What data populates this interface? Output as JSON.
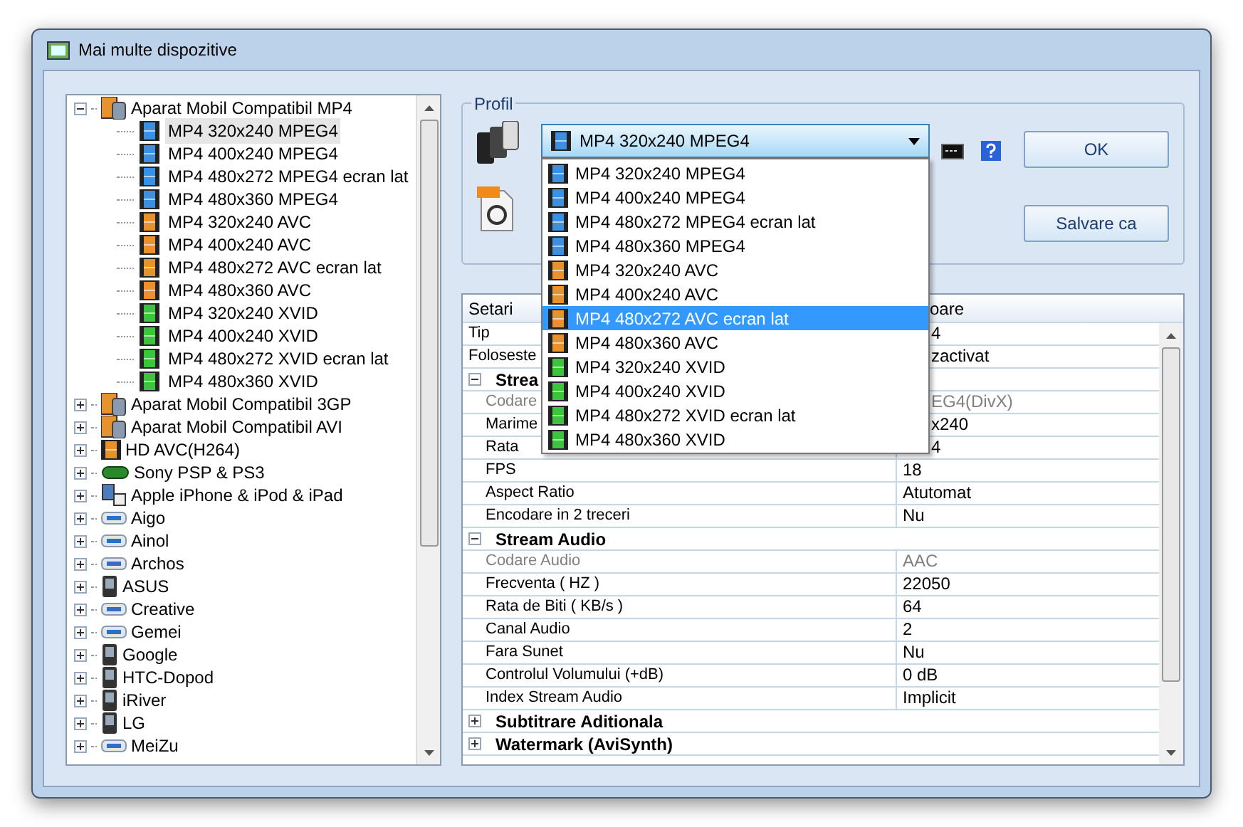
{
  "window": {
    "title": "Mai multe dispozitive"
  },
  "tree": [
    {
      "label": "Aparat Mobil Compatibil MP4",
      "kind": "phone-film",
      "expanded": true,
      "children": [
        {
          "label": "MP4 320x240 MPEG4",
          "color": "#3d8fe0",
          "selected": true
        },
        {
          "label": "MP4 400x240 MPEG4",
          "color": "#3d8fe0",
          "selected": false
        },
        {
          "label": "MP4 480x272 MPEG4 ecran lat",
          "color": "#3d8fe0",
          "selected": false
        },
        {
          "label": "MP4 480x360 MPEG4",
          "color": "#3d8fe0",
          "selected": false
        },
        {
          "label": "MP4 320x240 AVC",
          "color": "#e8922e",
          "selected": false
        },
        {
          "label": "MP4 400x240 AVC",
          "color": "#e8922e",
          "selected": false
        },
        {
          "label": "MP4 480x272 AVC ecran lat",
          "color": "#e8922e",
          "selected": false
        },
        {
          "label": "MP4 480x360 AVC",
          "color": "#e8922e",
          "selected": false
        },
        {
          "label": "MP4 320x240 XVID",
          "color": "#3cc43c",
          "selected": false
        },
        {
          "label": "MP4 400x240 XVID",
          "color": "#3cc43c",
          "selected": false
        },
        {
          "label": "MP4 480x272 XVID ecran lat",
          "color": "#3cc43c",
          "selected": false
        },
        {
          "label": "MP4 480x360 XVID",
          "color": "#3cc43c",
          "selected": false
        }
      ]
    },
    {
      "label": "Aparat Mobil Compatibil 3GP",
      "kind": "phone-film",
      "expanded": false
    },
    {
      "label": "Aparat Mobil Compatibil AVI",
      "kind": "phone-film",
      "expanded": false
    },
    {
      "label": "HD AVC(H264)",
      "kind": "film",
      "expanded": false
    },
    {
      "label": "Sony PSP & PS3",
      "kind": "console",
      "expanded": false
    },
    {
      "label": "Apple iPhone & iPod & iPad",
      "kind": "ipod",
      "expanded": false
    },
    {
      "label": "Aigo",
      "kind": "player",
      "expanded": false
    },
    {
      "label": "Ainol",
      "kind": "player",
      "expanded": false
    },
    {
      "label": "Archos",
      "kind": "player",
      "expanded": false
    },
    {
      "label": "ASUS",
      "kind": "phone",
      "expanded": false
    },
    {
      "label": "Creative",
      "kind": "player",
      "expanded": false
    },
    {
      "label": "Gemei",
      "kind": "player",
      "expanded": false
    },
    {
      "label": "Google",
      "kind": "phone",
      "expanded": false
    },
    {
      "label": "HTC-Dopod",
      "kind": "phone",
      "expanded": false
    },
    {
      "label": "iRiver",
      "kind": "phone",
      "expanded": false
    },
    {
      "label": "LG",
      "kind": "phone",
      "expanded": false
    },
    {
      "label": "MeiZu",
      "kind": "player",
      "expanded": false
    }
  ],
  "profile": {
    "legend": "Profil",
    "current": {
      "label": "MP4 320x240 MPEG4",
      "color": "#3d8fe0"
    },
    "expanded": true,
    "options": [
      {
        "label": "MP4 320x240 MPEG4",
        "color": "#3d8fe0",
        "selected": false
      },
      {
        "label": "MP4 400x240 MPEG4",
        "color": "#3d8fe0",
        "selected": false
      },
      {
        "label": "MP4 480x272 MPEG4 ecran lat",
        "color": "#3d8fe0",
        "selected": false
      },
      {
        "label": "MP4 480x360 MPEG4",
        "color": "#3d8fe0",
        "selected": false
      },
      {
        "label": "MP4 320x240 AVC",
        "color": "#e8922e",
        "selected": false
      },
      {
        "label": "MP4 400x240 AVC",
        "color": "#e8922e",
        "selected": false
      },
      {
        "label": "MP4 480x272 AVC ecran lat",
        "color": "#e8922e",
        "selected": true
      },
      {
        "label": "MP4 480x360 AVC",
        "color": "#e8922e",
        "selected": false
      },
      {
        "label": "MP4 320x240 XVID",
        "color": "#3cc43c",
        "selected": false
      },
      {
        "label": "MP4 400x240 XVID",
        "color": "#3cc43c",
        "selected": false
      },
      {
        "label": "MP4 480x272 XVID ecran lat",
        "color": "#3cc43c",
        "selected": false
      },
      {
        "label": "MP4 480x360 XVID",
        "color": "#3cc43c",
        "selected": false
      }
    ],
    "buttons": [
      "OK",
      "Salvare ca"
    ]
  },
  "grid": {
    "columns": [
      "Setari",
      "oare"
    ],
    "rows": [
      {
        "kind": "row",
        "name": "Tip",
        "value": "4",
        "covered": true,
        "disabled": false
      },
      {
        "kind": "row",
        "name": "Foloseste",
        "value": "zactivat",
        "covered": true,
        "disabled": false
      },
      {
        "kind": "group",
        "name": "Strea",
        "expanded": true
      },
      {
        "kind": "row",
        "name": "Codare",
        "value": "EG4(DivX)",
        "covered": true,
        "disabled": true
      },
      {
        "kind": "row",
        "name": "Marime",
        "value": "x240",
        "covered": true,
        "disabled": false
      },
      {
        "kind": "row",
        "name": "Rata",
        "value": "4",
        "covered": true,
        "disabled": false
      },
      {
        "kind": "row",
        "name": "FPS",
        "value": "18",
        "covered": false,
        "disabled": false
      },
      {
        "kind": "row",
        "name": "Aspect Ratio",
        "value": "Atutomat",
        "covered": false,
        "disabled": false
      },
      {
        "kind": "row",
        "name": "Encodare in 2 treceri",
        "value": "Nu",
        "covered": false,
        "disabled": false
      },
      {
        "kind": "group",
        "name": "Stream Audio",
        "expanded": true
      },
      {
        "kind": "row",
        "name": "Codare Audio",
        "value": "AAC",
        "covered": false,
        "disabled": true
      },
      {
        "kind": "row",
        "name": "Frecventa ( HZ )",
        "value": "22050",
        "covered": false,
        "disabled": false
      },
      {
        "kind": "row",
        "name": "Rata de Biti ( KB/s )",
        "value": "64",
        "covered": false,
        "disabled": false
      },
      {
        "kind": "row",
        "name": "Canal Audio",
        "value": "2",
        "covered": false,
        "disabled": false
      },
      {
        "kind": "row",
        "name": "Fara Sunet",
        "value": "Nu",
        "covered": false,
        "disabled": false
      },
      {
        "kind": "row",
        "name": "Controlul Volumului (+dB)",
        "value": "0 dB",
        "covered": false,
        "disabled": false
      },
      {
        "kind": "row",
        "name": "Index Stream Audio",
        "value": "Implicit",
        "covered": false,
        "disabled": false
      },
      {
        "kind": "group",
        "name": "Subtitrare Aditionala",
        "expanded": false
      },
      {
        "kind": "group",
        "name": "Watermark (AviSynth)",
        "expanded": false
      }
    ]
  }
}
